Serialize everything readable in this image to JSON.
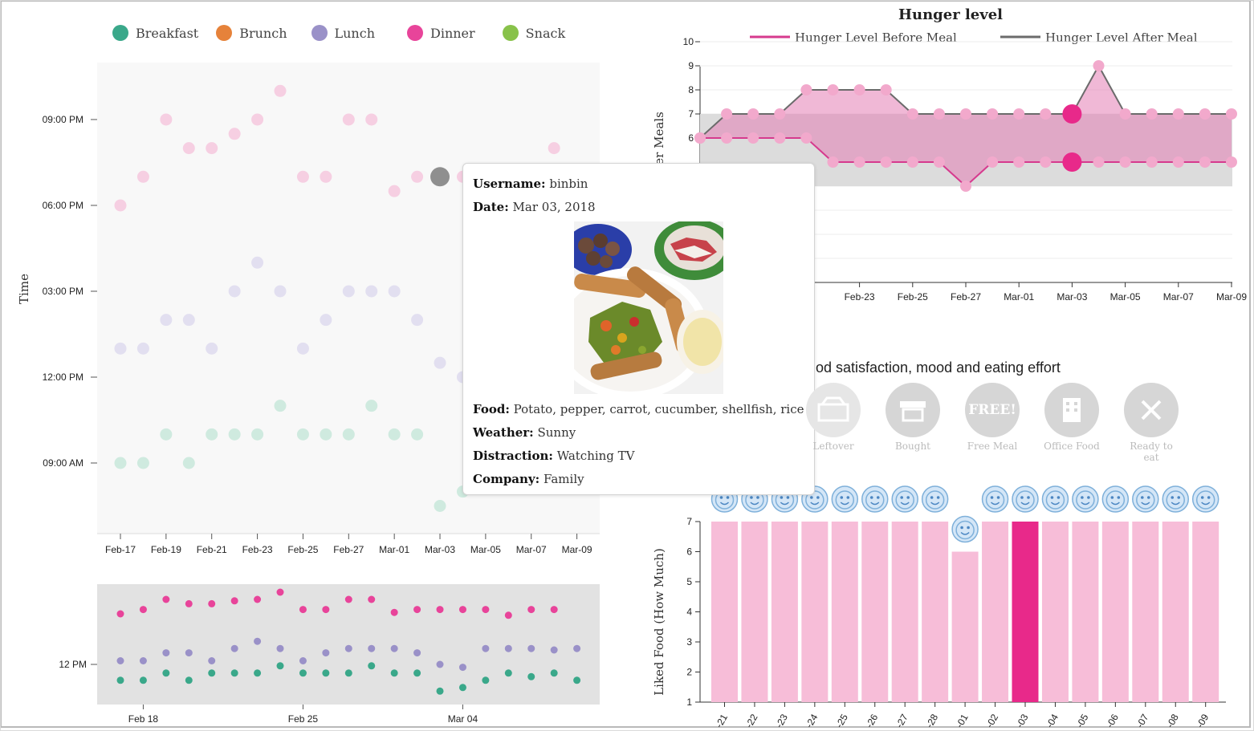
{
  "legend": [
    {
      "label": "Breakfast",
      "color": "#3aa88a"
    },
    {
      "label": "Brunch",
      "color": "#e6823a"
    },
    {
      "label": "Lunch",
      "color": "#9a91c8"
    },
    {
      "label": "Dinner",
      "color": "#e8449a"
    },
    {
      "label": "Snack",
      "color": "#88c24a"
    }
  ],
  "colors": {
    "before": "#d63a8e",
    "after": "#6b6b6b",
    "light_pink": "#f7bdd8",
    "selected": "#e8298a",
    "grey_band": "#dcdcdc"
  },
  "tooltip": {
    "username_label": "Username:",
    "username": "binbin",
    "date_label": "Date:",
    "date": "Mar 03, 2018",
    "food_label": "Food:",
    "food": "Potato, pepper, carrot, cucumber, shellfish, rice",
    "weather_label": "Weather:",
    "weather": "Sunny",
    "distraction_label": "Distraction:",
    "distraction": "Watching TV",
    "company_label": "Company:",
    "company": "Family"
  },
  "satisfaction": {
    "title": "od satisfaction, mood and eating effort",
    "icons": [
      {
        "label": "Leftover",
        "icon": "leftover-icon"
      },
      {
        "label": "Bought",
        "icon": "store-icon"
      },
      {
        "label": "Free Meal",
        "icon": "free-badge-icon",
        "badge": "FREE!"
      },
      {
        "label": "Office Food",
        "icon": "office-building-icon"
      },
      {
        "label": "Ready to eat",
        "icon": "fork-knife-icon"
      }
    ]
  },
  "chart_data": [
    {
      "type": "scatter",
      "name": "meal-times",
      "ylabel": "Time",
      "x_ticks": [
        "Feb-17",
        "Feb-19",
        "Feb-21",
        "Feb-23",
        "Feb-25",
        "Feb-27",
        "Mar-01",
        "Mar-03",
        "Mar-05",
        "Mar-07",
        "Mar-09"
      ],
      "y_ticks": [
        {
          "hour": 9,
          "label": "09:00 AM"
        },
        {
          "hour": 12,
          "label": "12:00 PM"
        },
        {
          "hour": 15,
          "label": "03:00 PM"
        },
        {
          "hour": 18,
          "label": "06:00 PM"
        },
        {
          "hour": 21,
          "label": "09:00 PM"
        }
      ],
      "series": [
        {
          "name": "Dinner",
          "points": [
            [
              "2018-02-17",
              18.0
            ],
            [
              "2018-02-18",
              19.0
            ],
            [
              "2018-02-19",
              21.0
            ],
            [
              "2018-02-20",
              20.0
            ],
            [
              "2018-02-21",
              20.0
            ],
            [
              "2018-02-22",
              20.5
            ],
            [
              "2018-02-23",
              21.0
            ],
            [
              "2018-02-24",
              22.0
            ],
            [
              "2018-02-25",
              19.0
            ],
            [
              "2018-02-26",
              19.0
            ],
            [
              "2018-02-27",
              21.0
            ],
            [
              "2018-02-28",
              21.0
            ],
            [
              "2018-03-01",
              18.5
            ],
            [
              "2018-03-02",
              19.0
            ],
            [
              "2018-03-03",
              19.0
            ],
            [
              "2018-03-04",
              19.0
            ],
            [
              "2018-03-08",
              20.0
            ]
          ]
        },
        {
          "name": "Lunch",
          "points": [
            [
              "2018-02-17",
              13.0
            ],
            [
              "2018-02-18",
              13.0
            ],
            [
              "2018-02-19",
              14.0
            ],
            [
              "2018-02-20",
              14.0
            ],
            [
              "2018-02-21",
              13.0
            ],
            [
              "2018-02-22",
              15.0
            ],
            [
              "2018-02-23",
              16.0
            ],
            [
              "2018-02-24",
              15.0
            ],
            [
              "2018-02-25",
              13.0
            ],
            [
              "2018-02-26",
              14.0
            ],
            [
              "2018-02-27",
              15.0
            ],
            [
              "2018-02-28",
              15.0
            ],
            [
              "2018-03-01",
              15.0
            ],
            [
              "2018-03-02",
              14.0
            ],
            [
              "2018-03-03",
              12.5
            ],
            [
              "2018-03-04",
              12.0
            ]
          ]
        },
        {
          "name": "Breakfast",
          "points": [
            [
              "2018-02-17",
              9.0
            ],
            [
              "2018-02-18",
              9.0
            ],
            [
              "2018-02-19",
              10.0
            ],
            [
              "2018-02-20",
              9.0
            ],
            [
              "2018-02-21",
              10.0
            ],
            [
              "2018-02-22",
              10.0
            ],
            [
              "2018-02-23",
              10.0
            ],
            [
              "2018-02-24",
              11.0
            ],
            [
              "2018-02-25",
              10.0
            ],
            [
              "2018-02-26",
              10.0
            ],
            [
              "2018-02-27",
              10.0
            ],
            [
              "2018-02-28",
              11.0
            ],
            [
              "2018-03-01",
              10.0
            ],
            [
              "2018-03-02",
              10.0
            ],
            [
              "2018-03-03",
              7.5
            ],
            [
              "2018-03-04",
              8.0
            ]
          ]
        }
      ],
      "selected": [
        "2018-03-03",
        19.0
      ]
    },
    {
      "type": "scatter",
      "name": "meal-times-overview",
      "x_ticks": [
        "Feb 18",
        "Feb 25",
        "Mar 04"
      ],
      "y_ticks": [
        "12 PM"
      ],
      "series": [
        {
          "name": "Dinner",
          "points": [
            [
              "2018-02-17",
              19.0
            ],
            [
              "2018-02-18",
              19.6
            ],
            [
              "2018-02-19",
              21.0
            ],
            [
              "2018-02-20",
              20.4
            ],
            [
              "2018-02-21",
              20.4
            ],
            [
              "2018-02-22",
              20.8
            ],
            [
              "2018-02-23",
              21.0
            ],
            [
              "2018-02-24",
              22.0
            ],
            [
              "2018-02-25",
              19.6
            ],
            [
              "2018-02-26",
              19.6
            ],
            [
              "2018-02-27",
              21.0
            ],
            [
              "2018-02-28",
              21.0
            ],
            [
              "2018-03-01",
              19.2
            ],
            [
              "2018-03-02",
              19.6
            ],
            [
              "2018-03-03",
              19.6
            ],
            [
              "2018-03-04",
              19.6
            ],
            [
              "2018-03-05",
              19.6
            ],
            [
              "2018-03-06",
              18.8
            ],
            [
              "2018-03-07",
              19.6
            ],
            [
              "2018-03-08",
              19.6
            ]
          ]
        },
        {
          "name": "Lunch",
          "points": [
            [
              "2018-02-17",
              12.5
            ],
            [
              "2018-02-18",
              12.5
            ],
            [
              "2018-02-19",
              13.6
            ],
            [
              "2018-02-20",
              13.6
            ],
            [
              "2018-02-21",
              12.5
            ],
            [
              "2018-02-22",
              14.2
            ],
            [
              "2018-02-23",
              15.2
            ],
            [
              "2018-02-24",
              14.2
            ],
            [
              "2018-02-25",
              12.5
            ],
            [
              "2018-02-26",
              13.6
            ],
            [
              "2018-02-27",
              14.2
            ],
            [
              "2018-02-28",
              14.2
            ],
            [
              "2018-03-01",
              14.2
            ],
            [
              "2018-03-02",
              13.6
            ],
            [
              "2018-03-03",
              12.0
            ],
            [
              "2018-03-04",
              11.6
            ],
            [
              "2018-03-05",
              14.2
            ],
            [
              "2018-03-06",
              14.2
            ],
            [
              "2018-03-07",
              14.2
            ],
            [
              "2018-03-08",
              14.0
            ],
            [
              "2018-03-09",
              14.2
            ]
          ]
        },
        {
          "name": "Breakfast",
          "points": [
            [
              "2018-02-17",
              9.8
            ],
            [
              "2018-02-18",
              9.8
            ],
            [
              "2018-02-19",
              10.8
            ],
            [
              "2018-02-20",
              9.8
            ],
            [
              "2018-02-21",
              10.8
            ],
            [
              "2018-02-22",
              10.8
            ],
            [
              "2018-02-23",
              10.8
            ],
            [
              "2018-02-24",
              11.8
            ],
            [
              "2018-02-25",
              10.8
            ],
            [
              "2018-02-26",
              10.8
            ],
            [
              "2018-02-27",
              10.8
            ],
            [
              "2018-02-28",
              11.8
            ],
            [
              "2018-03-01",
              10.8
            ],
            [
              "2018-03-02",
              10.8
            ],
            [
              "2018-03-03",
              8.3
            ],
            [
              "2018-03-04",
              8.8
            ],
            [
              "2018-03-05",
              9.8
            ],
            [
              "2018-03-06",
              10.8
            ],
            [
              "2018-03-07",
              10.3
            ],
            [
              "2018-03-08",
              10.8
            ],
            [
              "2018-03-09",
              9.8
            ]
          ]
        }
      ]
    },
    {
      "type": "line",
      "name": "hunger-level",
      "title": "Hunger level",
      "ylabel": "and After Meals",
      "ylim": [
        0,
        10
      ],
      "y_ticks": [
        6,
        7,
        8,
        9,
        10
      ],
      "x_ticks": [
        "21",
        "Feb-23",
        "Feb-25",
        "Feb-27",
        "Mar-01",
        "Mar-03",
        "Mar-05",
        "Mar-07",
        "Mar-09"
      ],
      "dates": [
        "2018-02-17",
        "2018-02-18",
        "2018-02-19",
        "2018-02-20",
        "2018-02-21",
        "2018-02-22",
        "2018-02-23",
        "2018-02-24",
        "2018-02-25",
        "2018-02-26",
        "2018-02-27",
        "2018-02-28",
        "2018-03-01",
        "2018-03-02",
        "2018-03-03",
        "2018-03-04",
        "2018-03-05",
        "2018-03-06",
        "2018-03-07",
        "2018-03-08",
        "2018-03-09"
      ],
      "series": [
        {
          "name": "Hunger Level Before Meal",
          "values": [
            6,
            6,
            6,
            6,
            6,
            5,
            5,
            5,
            5,
            5,
            4,
            5,
            5,
            5,
            5,
            5,
            5,
            5,
            5,
            5,
            5
          ]
        },
        {
          "name": "Hunger Level After Meal",
          "values": [
            6,
            7,
            7,
            7,
            8,
            8,
            8,
            8,
            7,
            7,
            7,
            7,
            7,
            7,
            7,
            9,
            7,
            7,
            7,
            7,
            7
          ]
        }
      ],
      "band": [
        4,
        7
      ],
      "selected": "2018-03-03"
    },
    {
      "type": "bar",
      "name": "liked-food",
      "ylabel": "Liked Food (How Much)",
      "ylim": [
        1,
        7
      ],
      "y_ticks": [
        1,
        2,
        3,
        4,
        5,
        6,
        7
      ],
      "categories": [
        "-21",
        "-22",
        "-23",
        "-24",
        "-25",
        "-26",
        "-27",
        "-28",
        "-01",
        "-02",
        "-03",
        "-04",
        "-05",
        "-06",
        "-07",
        "-08",
        "-09"
      ],
      "values": [
        7,
        7,
        7,
        7,
        7,
        7,
        7,
        7,
        6,
        7,
        7,
        7,
        7,
        7,
        7,
        7,
        7
      ],
      "selected": "-03"
    }
  ]
}
